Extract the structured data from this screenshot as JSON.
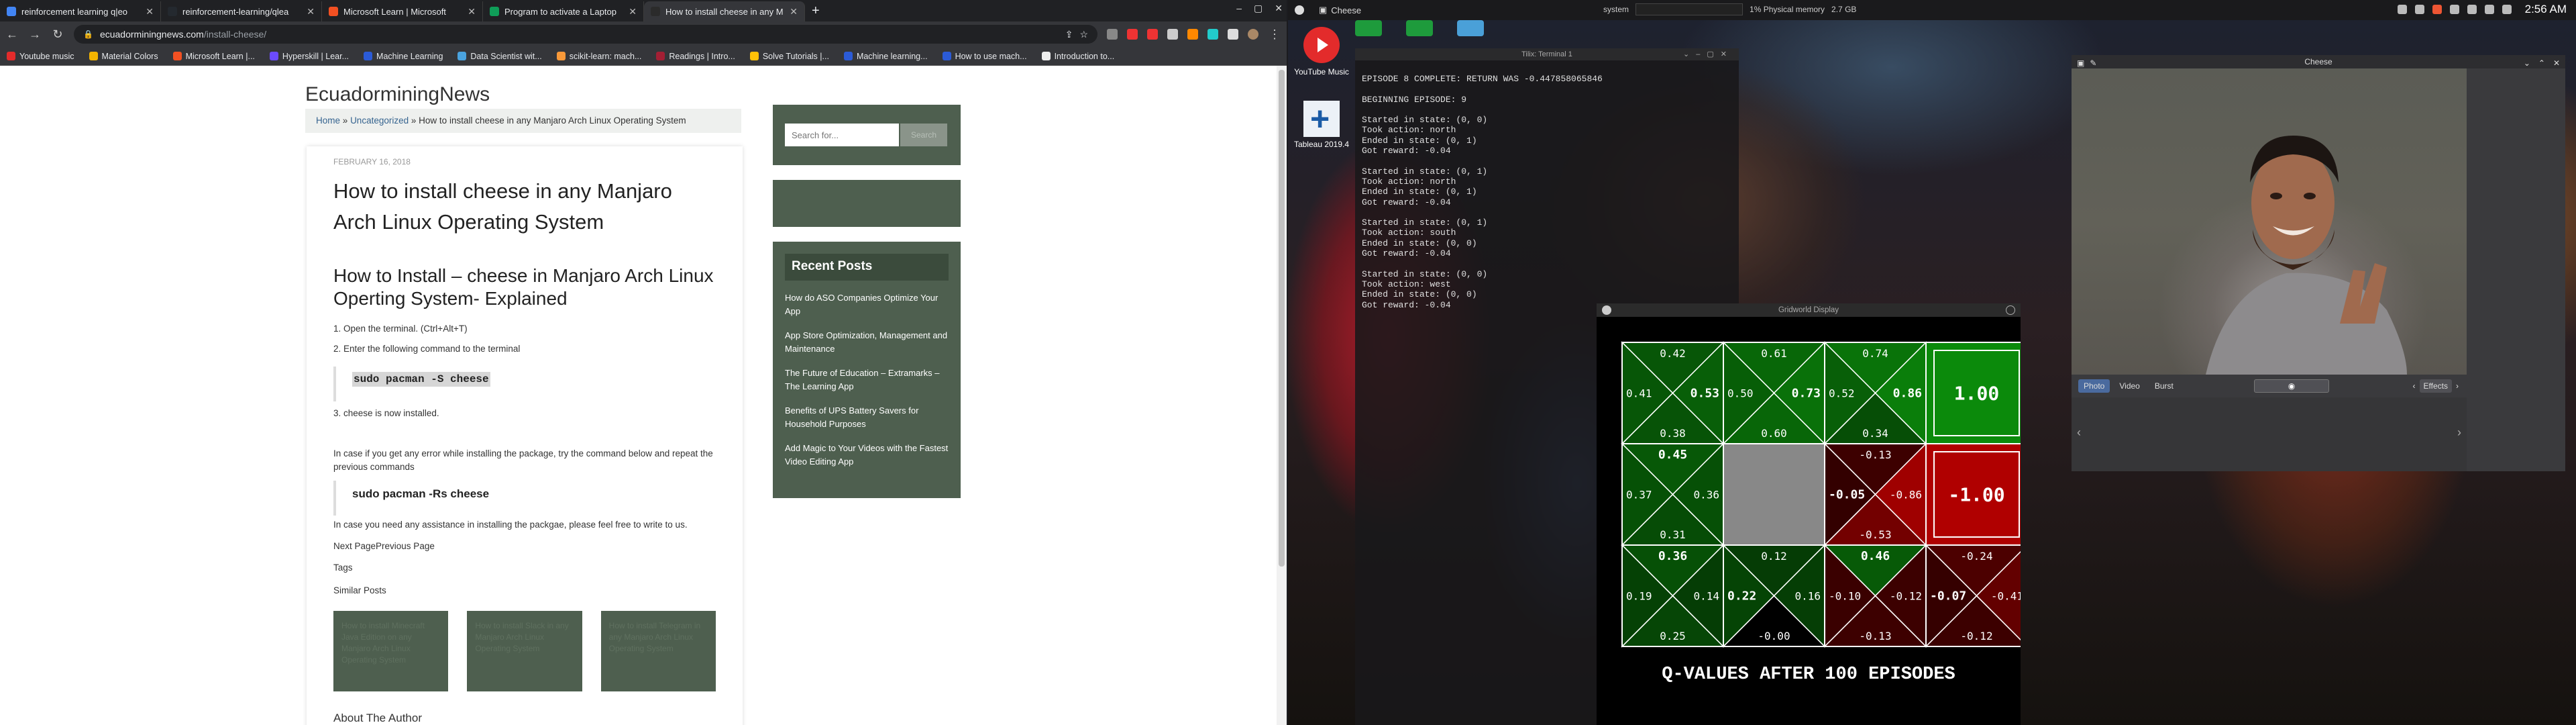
{
  "browser": {
    "tabs": [
      {
        "title": "reinforcement learning q|eo",
        "color": "#4285f4",
        "active": false
      },
      {
        "title": "reinforcement-learning/qlea",
        "color": "#24292f",
        "active": false
      },
      {
        "title": "Microsoft Learn | Microsoft",
        "color": "#f25022",
        "active": false
      },
      {
        "title": "Program to activate a Laptop",
        "color": "#0f9d58",
        "active": false
      },
      {
        "title": "How to install cheese in any M",
        "color": "#2b2b2b",
        "active": true
      }
    ],
    "new_tab_symbol": "+",
    "url_domain": "ecuadorminingnews.com",
    "url_path": "/install-cheese/",
    "bookmarks": [
      {
        "label": "Youtube music",
        "color": "#e32b2b"
      },
      {
        "label": "Material Colors",
        "color": "#f4b400"
      },
      {
        "label": "Microsoft Learn |...",
        "color": "#f25022"
      },
      {
        "label": "Hyperskill | Lear...",
        "color": "#6b4bff"
      },
      {
        "label": "Machine Learning",
        "color": "#2b5bd7"
      },
      {
        "label": "Data Scientist wit...",
        "color": "#4aa3df"
      },
      {
        "label": "scikit-learn: mach...",
        "color": "#f89939"
      },
      {
        "label": "Readings | Intro...",
        "color": "#a31f34"
      },
      {
        "label": "Solve Tutorials |...",
        "color": "#ffc107"
      },
      {
        "label": "Machine learning...",
        "color": "#2b5bd7"
      },
      {
        "label": "How to use mach...",
        "color": "#2b5bd7"
      },
      {
        "label": "Introduction to...",
        "color": "#eeeeee"
      }
    ]
  },
  "page": {
    "site_name": "EcuadorminingNews",
    "breadcrumb": {
      "home": "Home",
      "category": "Uncategorized",
      "sep": "»",
      "current": "How to install cheese in any Manjaro Arch Linux Operating System"
    },
    "date": "FEBRUARY 16, 2018",
    "title": "How to install cheese in any Manjaro Arch Linux Operating System",
    "heading2": "How to Install – cheese in Manjaro Arch Linux Operting System- Explained",
    "step1": "1. Open the terminal. (Ctrl+Alt+T)",
    "step2": "2. Enter the following command to the terminal",
    "code1": "sudo pacman -S cheese",
    "step3": "3. cheese is now installed.",
    "error_text": "In case if you get any error while installing the package, try the command below and repeat the previous commands",
    "code2": "sudo pacman -Rs cheese",
    "assist_text": "In case you need any assistance in installing the packgae, please feel free to write to us.",
    "next_prev": "Next PagePrevious Page",
    "tags_label": "Tags",
    "similar_label": "Similar Posts",
    "similar_posts": [
      "How to install Minecraft Java Edition on any Manjaro Arch Linux Operating System",
      "How to install Slack in any Manjaro Arch Linux Operating System",
      "How to install Telegram in any Manjaro Arch Linux Operating System"
    ],
    "about_label": "About The Author"
  },
  "sidebar": {
    "search_placeholder": "Search for...",
    "search_button": "Search",
    "recent_heading": "Recent Posts",
    "recent_posts": [
      "How do ASO Companies Optimize Your App",
      "App Store Optimization, Management and Maintenance",
      "The Future of Education – Extramarks – The Learning App",
      "Benefits of UPS Battery Savers for Household Purposes",
      "Add Magic to Your Videos with the Fastest Video Editing App"
    ]
  },
  "desktop": {
    "panel_app": "Cheese",
    "sysmon_label": "system",
    "sysmon_mem": "1% Physical memory",
    "sysmon_mem_val": "2.7 GB",
    "clock": "2:56 AM",
    "launchers": [
      {
        "label": "YouTube Music"
      },
      {
        "label": "Tableau 2019.4"
      }
    ]
  },
  "terminal": {
    "title": "Tilix: Terminal 1",
    "lines": [
      "EPISODE 8 COMPLETE: RETURN WAS -0.447858065846",
      "",
      "BEGINNING EPISODE: 9",
      "",
      "Started in state: (0, 0)",
      "Took action: north",
      "Ended in state: (0, 1)",
      "Got reward: -0.04",
      "",
      "Started in state: (0, 1)",
      "Took action: north",
      "Ended in state: (0, 1)",
      "Got reward: -0.04",
      "",
      "Started in state: (0, 1)",
      "Took action: south",
      "Ended in state: (0, 0)",
      "Got reward: -0.04",
      "",
      "Started in state: (0, 0)",
      "Took action: west",
      "Ended in state: (0, 0)",
      "Got reward: -0.04"
    ]
  },
  "gridworld": {
    "title": "Gridworld Display",
    "caption": "Q-VALUES AFTER 100 EPISODES",
    "colors": {
      "positive": "#0b8a0b",
      "negative": "#b00000",
      "wall": "#888888",
      "neutral": "#000000"
    },
    "cells": [
      {
        "row": 0,
        "col": 0,
        "type": "q",
        "n": "0.42",
        "s": "0.38",
        "w": "0.41",
        "e": "0.53",
        "best": "e"
      },
      {
        "row": 0,
        "col": 1,
        "type": "q",
        "n": "0.61",
        "s": "0.60",
        "w": "0.50",
        "e": "0.73",
        "best": "e"
      },
      {
        "row": 0,
        "col": 2,
        "type": "q",
        "n": "0.74",
        "s": "0.34",
        "w": "0.52",
        "e": "0.86",
        "best": "e"
      },
      {
        "row": 0,
        "col": 3,
        "type": "terminal",
        "value": "1.00"
      },
      {
        "row": 1,
        "col": 0,
        "type": "q",
        "n": "0.45",
        "s": "0.31",
        "w": "0.37",
        "e": "0.36",
        "best": "n"
      },
      {
        "row": 1,
        "col": 1,
        "type": "wall"
      },
      {
        "row": 1,
        "col": 2,
        "type": "q",
        "n": "-0.13",
        "s": "-0.53",
        "w": "-0.05",
        "e": "-0.86",
        "best": "w"
      },
      {
        "row": 1,
        "col": 3,
        "type": "terminal",
        "value": "-1.00"
      },
      {
        "row": 2,
        "col": 0,
        "type": "q",
        "n": "0.36",
        "s": "0.25",
        "w": "0.19",
        "e": "0.14",
        "best": "n"
      },
      {
        "row": 2,
        "col": 1,
        "type": "q",
        "n": "0.12",
        "s": "-0.00",
        "w": "0.22",
        "e": "0.16",
        "best": "w"
      },
      {
        "row": 2,
        "col": 2,
        "type": "q",
        "n": "0.46",
        "s": "-0.13",
        "w": "-0.10",
        "e": "-0.12",
        "best": "n"
      },
      {
        "row": 2,
        "col": 3,
        "type": "q",
        "n": "-0.24",
        "s": "-0.12",
        "w": "-0.07",
        "e": "-0.41",
        "best": "w"
      }
    ]
  },
  "cheese": {
    "title": "Cheese",
    "modes": [
      "Photo",
      "Video",
      "Burst"
    ],
    "active_mode": "Photo",
    "effects_label": "Effects"
  }
}
